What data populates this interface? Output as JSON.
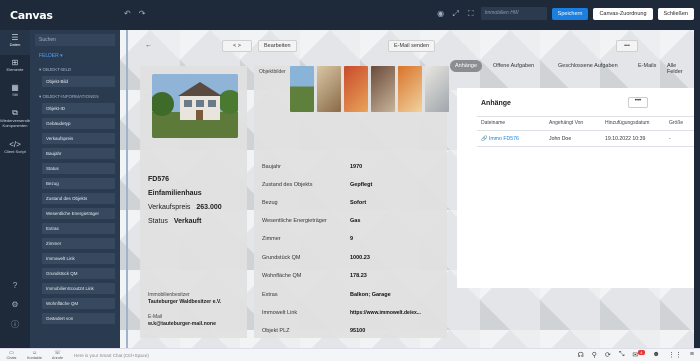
{
  "app": {
    "logo": "Canvas"
  },
  "topbar": {
    "search_placeholder": "Immobilien HW",
    "save_label": "Speichern",
    "assign_label": "Canvas-Zuordnung",
    "close_label": "Schließen"
  },
  "leftnav": {
    "items": [
      {
        "label": "Daten",
        "icon": "database-icon"
      },
      {
        "label": "Elemente",
        "icon": "elements-icon"
      },
      {
        "label": "Stil",
        "icon": "style-icon"
      },
      {
        "label": "Wiederverwendbare Komponenten",
        "icon": "components-icon"
      },
      {
        "label": "Client Script",
        "icon": "code-icon"
      }
    ]
  },
  "panel": {
    "search_placeholder": "Suchen",
    "section": "FELDER",
    "group1": "OBJEKT-BILD",
    "group1_items": [
      "Objekt-Bild"
    ],
    "group2": "OBJEKT-INFORMATIONEN",
    "group2_items": [
      "Objekt-ID",
      "Gebäudetyp",
      "Verkaufspreis",
      "Baujahr",
      "Status",
      "Bezug",
      "Zustand des Objekts",
      "Wesentliche Energieträger",
      "Extras",
      "Zimmer",
      "Immowelt Link",
      "Grundstück QM",
      "ImmobilienScout24 Link",
      "Wohnfläche QM",
      "Geändert von"
    ]
  },
  "toolbar": {
    "back": "←",
    "nav": "< >",
    "edit": "Bearbeiten",
    "email": "E-Mail senden",
    "more": "•••"
  },
  "object": {
    "id": "FD576",
    "type": "Einfamilienhaus",
    "price_label": "Verkaufspreis",
    "price": "263.000",
    "status_label": "Status",
    "status": "Verkauft",
    "owner_label": "Immobilienbesitzer",
    "owner": "Tauteburger Waldbesitzer e.V.",
    "email_label": "E-Mail",
    "email": "w.k@tauteburger-mail.none"
  },
  "images": {
    "label": "Objektbilder"
  },
  "properties": [
    {
      "label": "Baujahr",
      "value": "1970"
    },
    {
      "label": "Zustand des Objekts",
      "value": "Gepflegt"
    },
    {
      "label": "Bezug",
      "value": "Sofort"
    },
    {
      "label": "Wesentliche Energieträger",
      "value": "Gas"
    },
    {
      "label": "Zimmer",
      "value": "9"
    },
    {
      "label": "Grundstück QM",
      "value": "1000.23"
    },
    {
      "label": "Wohnfläche QM",
      "value": "178.23"
    },
    {
      "label": "Extras",
      "value": "Balkon; Garage"
    },
    {
      "label": "Immowelt Link",
      "value": "https://www.immowelt.de/ex..."
    },
    {
      "label": "Objekt PLZ",
      "value": "95100"
    }
  ],
  "tabs": [
    "Anhänge",
    "Offene Aufgaben",
    "Geschlossene Aufgaben",
    "E-Mails",
    "Alle Felder",
    "Exp"
  ],
  "attachments": {
    "title": "Anhänge",
    "more": "•••",
    "columns": [
      "Dateiname",
      "Angehängt Von",
      "Hinzufügungsdatum",
      "Größe"
    ],
    "rows": [
      {
        "file": "Immo FD576",
        "by": "John Doe",
        "date": "19.10.2022 10:39",
        "size": "-"
      }
    ]
  },
  "statusbar": {
    "items": [
      "Chats",
      "Kontakte",
      "Anrufe"
    ],
    "chat_placeholder": "Here is your Smart Chat (Ctrl+Space)",
    "badge": "4"
  },
  "colors": {
    "accent": "#1a7fe0",
    "nav_bg": "#1e2a3a",
    "panel_bg": "#2a3a4f"
  }
}
